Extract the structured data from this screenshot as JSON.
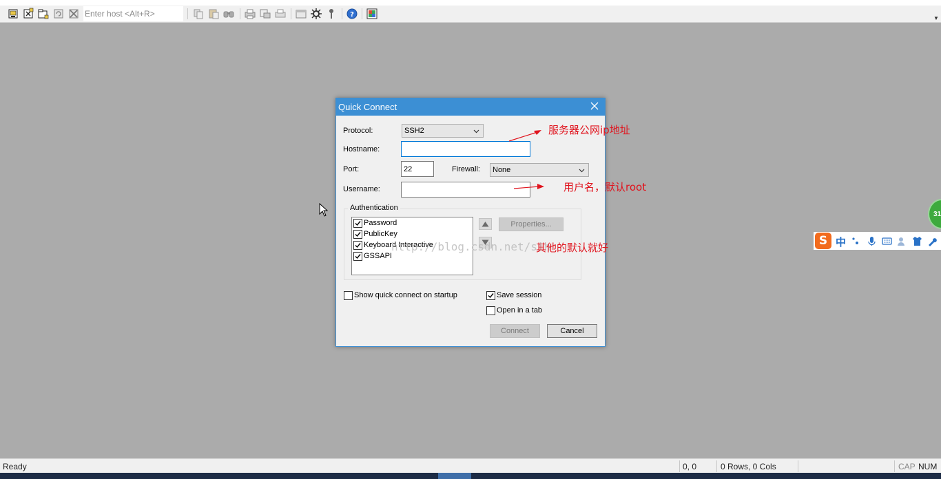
{
  "toolbar": {
    "host_placeholder": "Enter host <Alt+R>",
    "buttons": [
      "connect-icon",
      "quick-connect-icon",
      "connect-in-tab-icon",
      "reconnect-icon",
      "disconnect-icon",
      "copy-icon",
      "paste-icon",
      "find-icon",
      "print-icon",
      "print-setup-icon",
      "print-screen-icon",
      "session-options-icon",
      "global-options-icon",
      "keymap-icon",
      "help-icon",
      "sftp-icon"
    ]
  },
  "dialog": {
    "title": "Quick Connect",
    "protocol_label": "Protocol:",
    "protocol_value": "SSH2",
    "hostname_label": "Hostname:",
    "hostname_value": "",
    "port_label": "Port:",
    "port_value": "22",
    "firewall_label": "Firewall:",
    "firewall_value": "None",
    "username_label": "Username:",
    "username_value": "",
    "auth_group_label": "Authentication",
    "auth_items": [
      {
        "label": "Password",
        "checked": true
      },
      {
        "label": "PublicKey",
        "checked": true
      },
      {
        "label": "Keyboard Interactive",
        "checked": true
      },
      {
        "label": "GSSAPI",
        "checked": true
      }
    ],
    "properties_label": "Properties...",
    "show_on_startup_label": "Show quick connect on startup",
    "show_on_startup_checked": false,
    "save_session_label": "Save session",
    "save_session_checked": true,
    "open_in_tab_label": "Open in a tab",
    "open_in_tab_checked": false,
    "connect_label": "Connect",
    "cancel_label": "Cancel"
  },
  "annotations": {
    "hostname_note": "服务器公网ip地址",
    "username_note": "用户名，默认root",
    "others_note": "其他的默认就好",
    "watermark": "http://blog.csdn.net/sih"
  },
  "statusbar": {
    "status": "Ready",
    "cursor_pos": "0, 0",
    "size": "0 Rows, 0 Cols",
    "cap": "CAP",
    "num": "NUM"
  },
  "ime": {
    "logo": "S",
    "mode": "中",
    "badge": "31"
  },
  "colors": {
    "accent": "#3c8fd4",
    "annotation_red": "#e0141e",
    "desktop_gray": "#ababab"
  }
}
